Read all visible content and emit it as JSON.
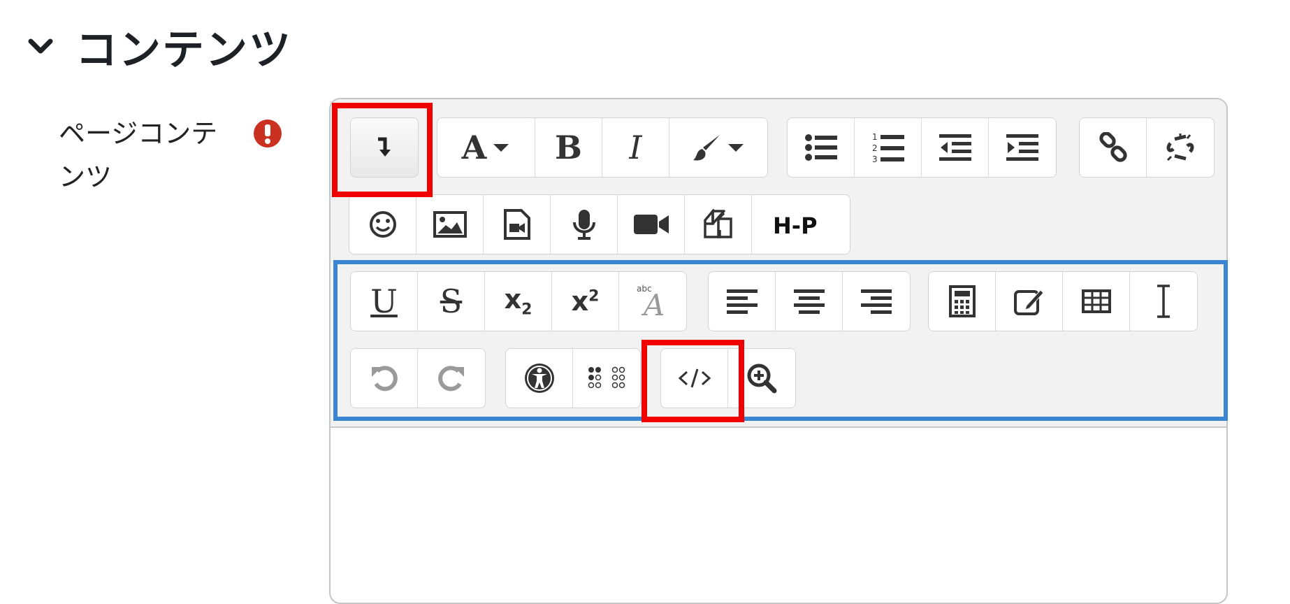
{
  "section": {
    "title": "コンテンツ",
    "toggle_icon": "chevron-down-icon"
  },
  "field": {
    "label": "ページコンテンツ",
    "required_icon": "exclamation-circle-icon",
    "required_color": "#ca3120"
  },
  "editor": {
    "toolbar": {
      "row1": {
        "collapse": {
          "icon": "collapse-arrow-icon"
        },
        "style": [
          "font-style-icon",
          "bold-icon",
          "italic-icon",
          "text-color-icon"
        ],
        "lists": [
          "unordered-list-icon",
          "ordered-list-icon",
          "outdent-icon",
          "indent-icon"
        ],
        "links": [
          "link-icon",
          "unlink-icon"
        ]
      },
      "row2": [
        "emoji-icon",
        "image-icon",
        "media-icon",
        "record-audio-icon",
        "record-video-icon",
        "manage-files-icon",
        "h5p-icon"
      ],
      "row3": {
        "format": [
          "underline-icon",
          "strikethrough-icon",
          "subscript-icon",
          "superscript-icon",
          "clear-formatting-icon"
        ],
        "align": [
          "align-left-icon",
          "align-center-icon",
          "align-right-icon"
        ],
        "insert": [
          "equation-icon",
          "character-map-icon",
          "table-icon",
          "special-character-icon"
        ]
      },
      "row4": {
        "history": [
          "undo-icon",
          "redo-icon"
        ],
        "accessibility": [
          "accessibility-checker-icon",
          "screen-reader-helper-icon"
        ],
        "html": [
          "html-source-icon",
          "full-screen-zoom-icon"
        ]
      },
      "labels": {
        "style_letter": "A",
        "bold_letter": "B",
        "italic_letter": "I",
        "underline_letter": "U",
        "strike_letter": "S",
        "subscript": "x",
        "subscript_index": "2",
        "superscript": "x",
        "superscript_index": "2",
        "h5p": "H-P",
        "clear_fmt_small": "abc",
        "clear_fmt_letter": "A"
      }
    }
  },
  "colors": {
    "highlight_red": "#f00000",
    "highlight_blue": "#3a86d0",
    "toolbar_bg": "#f2f2f2"
  }
}
